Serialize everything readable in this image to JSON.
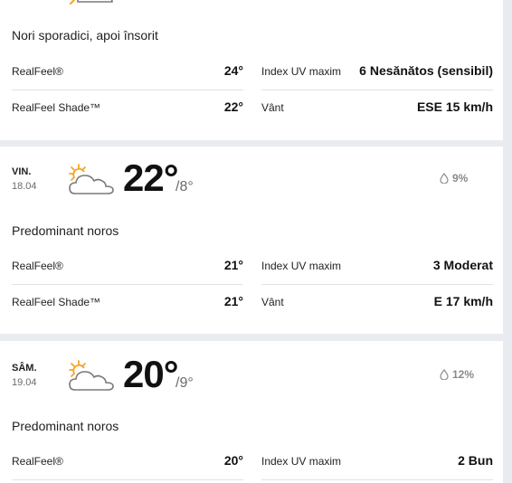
{
  "days": [
    {
      "phrase": "Nori sporadici, apoi însorit",
      "realfeel_label": "RealFeel®",
      "realfeel_value": "24°",
      "realfeel_shade_label": "RealFeel Shade™",
      "realfeel_shade_value": "22°",
      "uv_label": "Index UV maxim",
      "uv_value": "6 Nesănătos (sensibil)",
      "wind_label": "Vânt",
      "wind_value": "ESE 15 km/h",
      "icon": "partly-sunny-icon"
    },
    {
      "dow": "VIN.",
      "date": "18.04",
      "temp_hi": "22°",
      "temp_lo": "/8°",
      "precip": "9%",
      "phrase": "Predominant noros",
      "realfeel_label": "RealFeel®",
      "realfeel_value": "21°",
      "realfeel_shade_label": "RealFeel Shade™",
      "realfeel_shade_value": "21°",
      "uv_label": "Index UV maxim",
      "uv_value": "3 Moderat",
      "wind_label": "Vânt",
      "wind_value": "E 17 km/h",
      "icon": "mostly-cloudy-icon"
    },
    {
      "dow": "SÂM.",
      "date": "19.04",
      "temp_hi": "20°",
      "temp_lo": "/9°",
      "precip": "12%",
      "phrase": "Predominant noros",
      "realfeel_label": "RealFeel®",
      "realfeel_value": "20°",
      "uv_label": "Index UV maxim",
      "uv_value": "2 Bun",
      "icon": "mostly-cloudy-icon"
    }
  ],
  "colors": {
    "background": "#e8ebf0",
    "card": "#ffffff",
    "sun": "#f5a623",
    "cloud_stroke": "#7a7a7a",
    "muted": "#8a8a8a"
  }
}
